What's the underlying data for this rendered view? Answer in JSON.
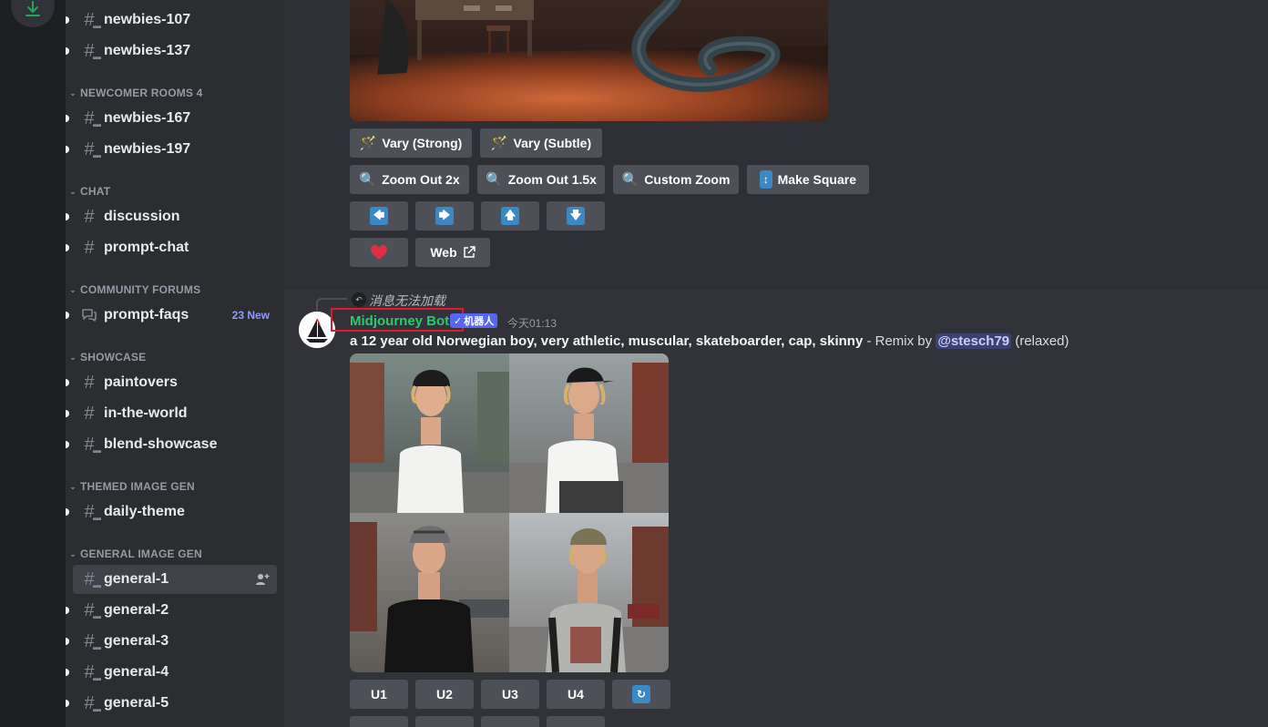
{
  "sidebar": {
    "channels_top": [
      {
        "name": "newbies-107"
      },
      {
        "name": "newbies-137"
      }
    ],
    "categories": {
      "newcomer_rooms_4": "NEWCOMER ROOMS 4",
      "chat": "CHAT",
      "community_forums": "COMMUNITY FORUMS",
      "showcase": "SHOWCASE",
      "themed_image_gen": "THEMED IMAGE GEN",
      "general_image_gen": "GENERAL IMAGE GEN"
    },
    "channels": {
      "newbies_167": "newbies-167",
      "newbies_197": "newbies-197",
      "discussion": "discussion",
      "prompt_chat": "prompt-chat",
      "prompt_faqs": "prompt-faqs",
      "prompt_faqs_badge": "23 New",
      "paintovers": "paintovers",
      "in_the_world": "in-the-world",
      "blend_showcase": "blend-showcase",
      "daily_theme": "daily-theme",
      "general_1": "general-1",
      "general_2": "general-2",
      "general_3": "general-3",
      "general_4": "general-4",
      "general_5": "general-5"
    }
  },
  "previous_message": {
    "buttons": {
      "vary_strong": "Vary (Strong)",
      "vary_subtle": "Vary (Subtle)",
      "zoom_out_2x": "Zoom Out 2x",
      "zoom_out_1_5x": "Zoom Out 1.5x",
      "custom_zoom": "Custom Zoom",
      "make_square": "Make Square",
      "web": "Web"
    }
  },
  "message": {
    "reply_text": "消息无法加载",
    "author": "Midjourney Bot",
    "bot_tag": "机器人",
    "timestamp": "今天01:13",
    "prompt_bold": "a 12 year old Norwegian boy, very athletic, muscular, skateboarder, cap, skinny",
    "prompt_rest": " - Remix by ",
    "mention": "@stesch79",
    "mode": " (relaxed)",
    "buttons": {
      "u1": "U1",
      "u2": "U2",
      "u3": "U3",
      "u4": "U4"
    }
  },
  "colors": {
    "accent": "#5865f2",
    "bot_name": "#2dc770",
    "highlight_box": "#e0182d",
    "new_badge": "#949cf7"
  }
}
